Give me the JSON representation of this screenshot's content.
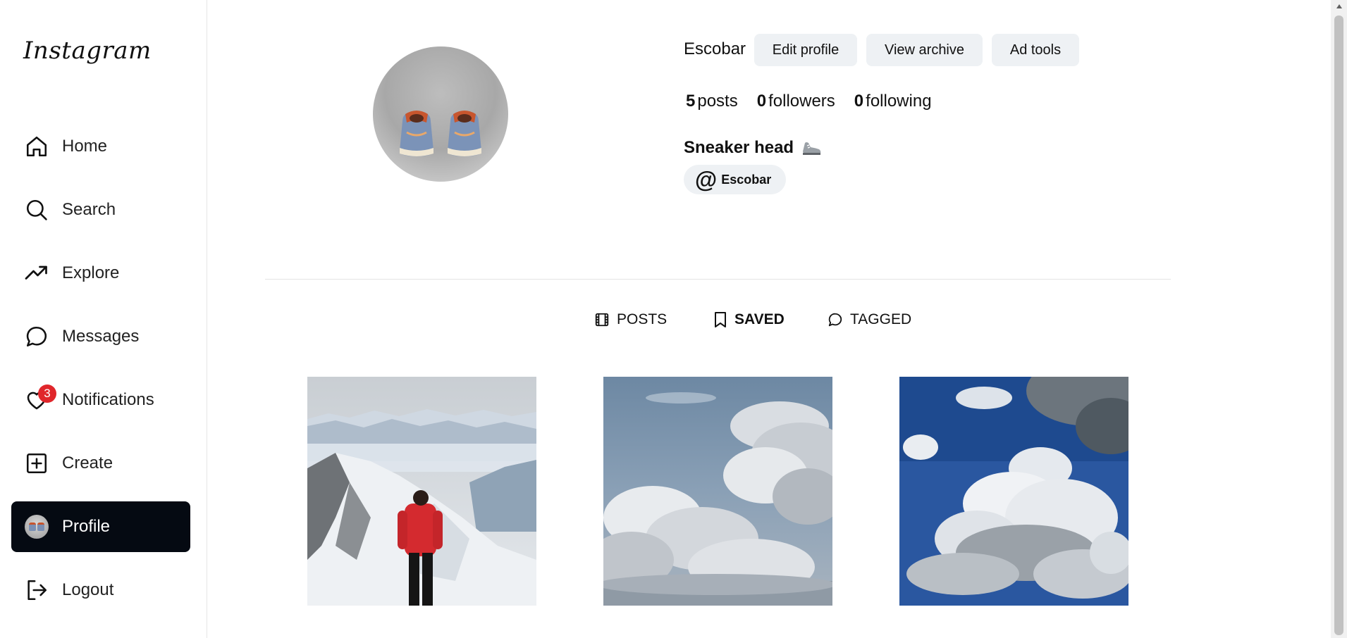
{
  "app": {
    "logo": "Instagram"
  },
  "sidebar": {
    "items": [
      {
        "label": "Home",
        "icon": "home-icon"
      },
      {
        "label": "Search",
        "icon": "search-icon"
      },
      {
        "label": "Explore",
        "icon": "trending-icon"
      },
      {
        "label": "Messages",
        "icon": "message-icon"
      },
      {
        "label": "Notifications",
        "icon": "heart-icon",
        "badge": "3"
      },
      {
        "label": "Create",
        "icon": "plus-square-icon"
      },
      {
        "label": "Profile",
        "icon": "avatar",
        "active": true
      },
      {
        "label": "Logout",
        "icon": "logout-icon"
      }
    ]
  },
  "profile": {
    "username": "Escobar",
    "buttons": {
      "edit": "Edit profile",
      "archive": "View archive",
      "ad_tools": "Ad tools"
    },
    "stats": {
      "posts_count": "5",
      "posts_label": "posts",
      "followers_count": "0",
      "followers_label": "followers",
      "following_count": "0",
      "following_label": "following"
    },
    "bio": "Sneaker head",
    "threads": {
      "at": "@",
      "name": "Escobar"
    }
  },
  "tabs": [
    {
      "label": "POSTS",
      "icon": "film-icon"
    },
    {
      "label": "SAVED",
      "icon": "bookmark-icon",
      "active": true
    },
    {
      "label": "TAGGED",
      "icon": "message-icon"
    }
  ],
  "posts": [
    {
      "subject": "hiker-on-snowy-mountain"
    },
    {
      "subject": "cumulus-clouds"
    },
    {
      "subject": "clouds-blue-sky"
    }
  ],
  "colors": {
    "active_nav": "#050a12",
    "badge": "#e0262b",
    "button_bg": "#eef1f4"
  }
}
